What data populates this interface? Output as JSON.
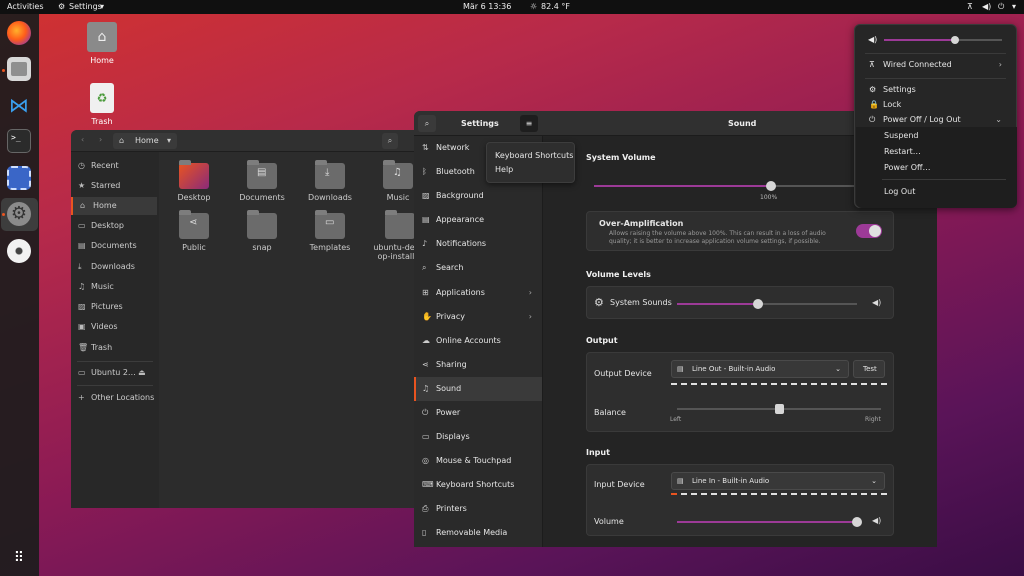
{
  "topbar": {
    "activities": "Activities",
    "app_menu": "Settings",
    "clock": "Mär 6  13:36",
    "weather": "82.4 °F"
  },
  "desktop": {
    "home_label": "Home",
    "trash_label": "Trash"
  },
  "files": {
    "location": "Home",
    "sidebar": [
      "Recent",
      "Starred",
      "Home",
      "Desktop",
      "Documents",
      "Downloads",
      "Music",
      "Pictures",
      "Videos",
      "Trash",
      "Ubuntu 2…",
      "Other Locations"
    ],
    "folders_row1": [
      "Desktop",
      "Documents",
      "Downloads",
      "Music"
    ],
    "folders_row2": [
      "Public",
      "snap",
      "Templates",
      "ubuntu-desktop-installer"
    ]
  },
  "settings": {
    "title": "Settings",
    "page_title": "Sound",
    "nav": [
      "Network",
      "Bluetooth",
      "Background",
      "Appearance",
      "Notifications",
      "Search",
      "Applications",
      "Privacy",
      "Online Accounts",
      "Sharing",
      "Sound",
      "Power",
      "Displays",
      "Mouse & Touchpad",
      "Keyboard Shortcuts",
      "Printers",
      "Removable Media"
    ],
    "active_nav": "Sound",
    "system_volume": {
      "title": "System Volume",
      "value": 100,
      "value_label": "100%"
    },
    "over_amplification": {
      "title": "Over-Amplification",
      "description_line1": "Allows raising the volume above 100%. This can result in a loss of audio",
      "description_line2": "quality; it is better to increase application volume settings, if possible.",
      "enabled": true
    },
    "volume_levels": {
      "title": "Volume Levels",
      "system_sounds_label": "System Sounds",
      "system_sounds_value": 45
    },
    "output": {
      "title": "Output",
      "device_label": "Output Device",
      "device_value": "Line Out - Built-in Audio",
      "test_label": "Test",
      "balance_label": "Balance",
      "balance_left": "Left",
      "balance_right": "Right",
      "balance_value": 50
    },
    "input": {
      "title": "Input",
      "device_label": "Input Device",
      "device_value": "Line In - Built-in Audio",
      "volume_label": "Volume",
      "volume_value": 100
    }
  },
  "menu_popover": {
    "items": [
      "Keyboard Shortcuts",
      "Help"
    ]
  },
  "system_menu": {
    "volume_value": 60,
    "wired": "Wired Connected",
    "settings": "Settings",
    "lock": "Lock",
    "power": "Power Off / Log Out",
    "suspend": "Suspend",
    "restart": "Restart…",
    "poweroff": "Power Off…",
    "logout": "Log Out"
  },
  "colors": {
    "accent": "#e95420",
    "slider_fill": "#9c3a97",
    "toggle_on": "#9c3a97"
  }
}
